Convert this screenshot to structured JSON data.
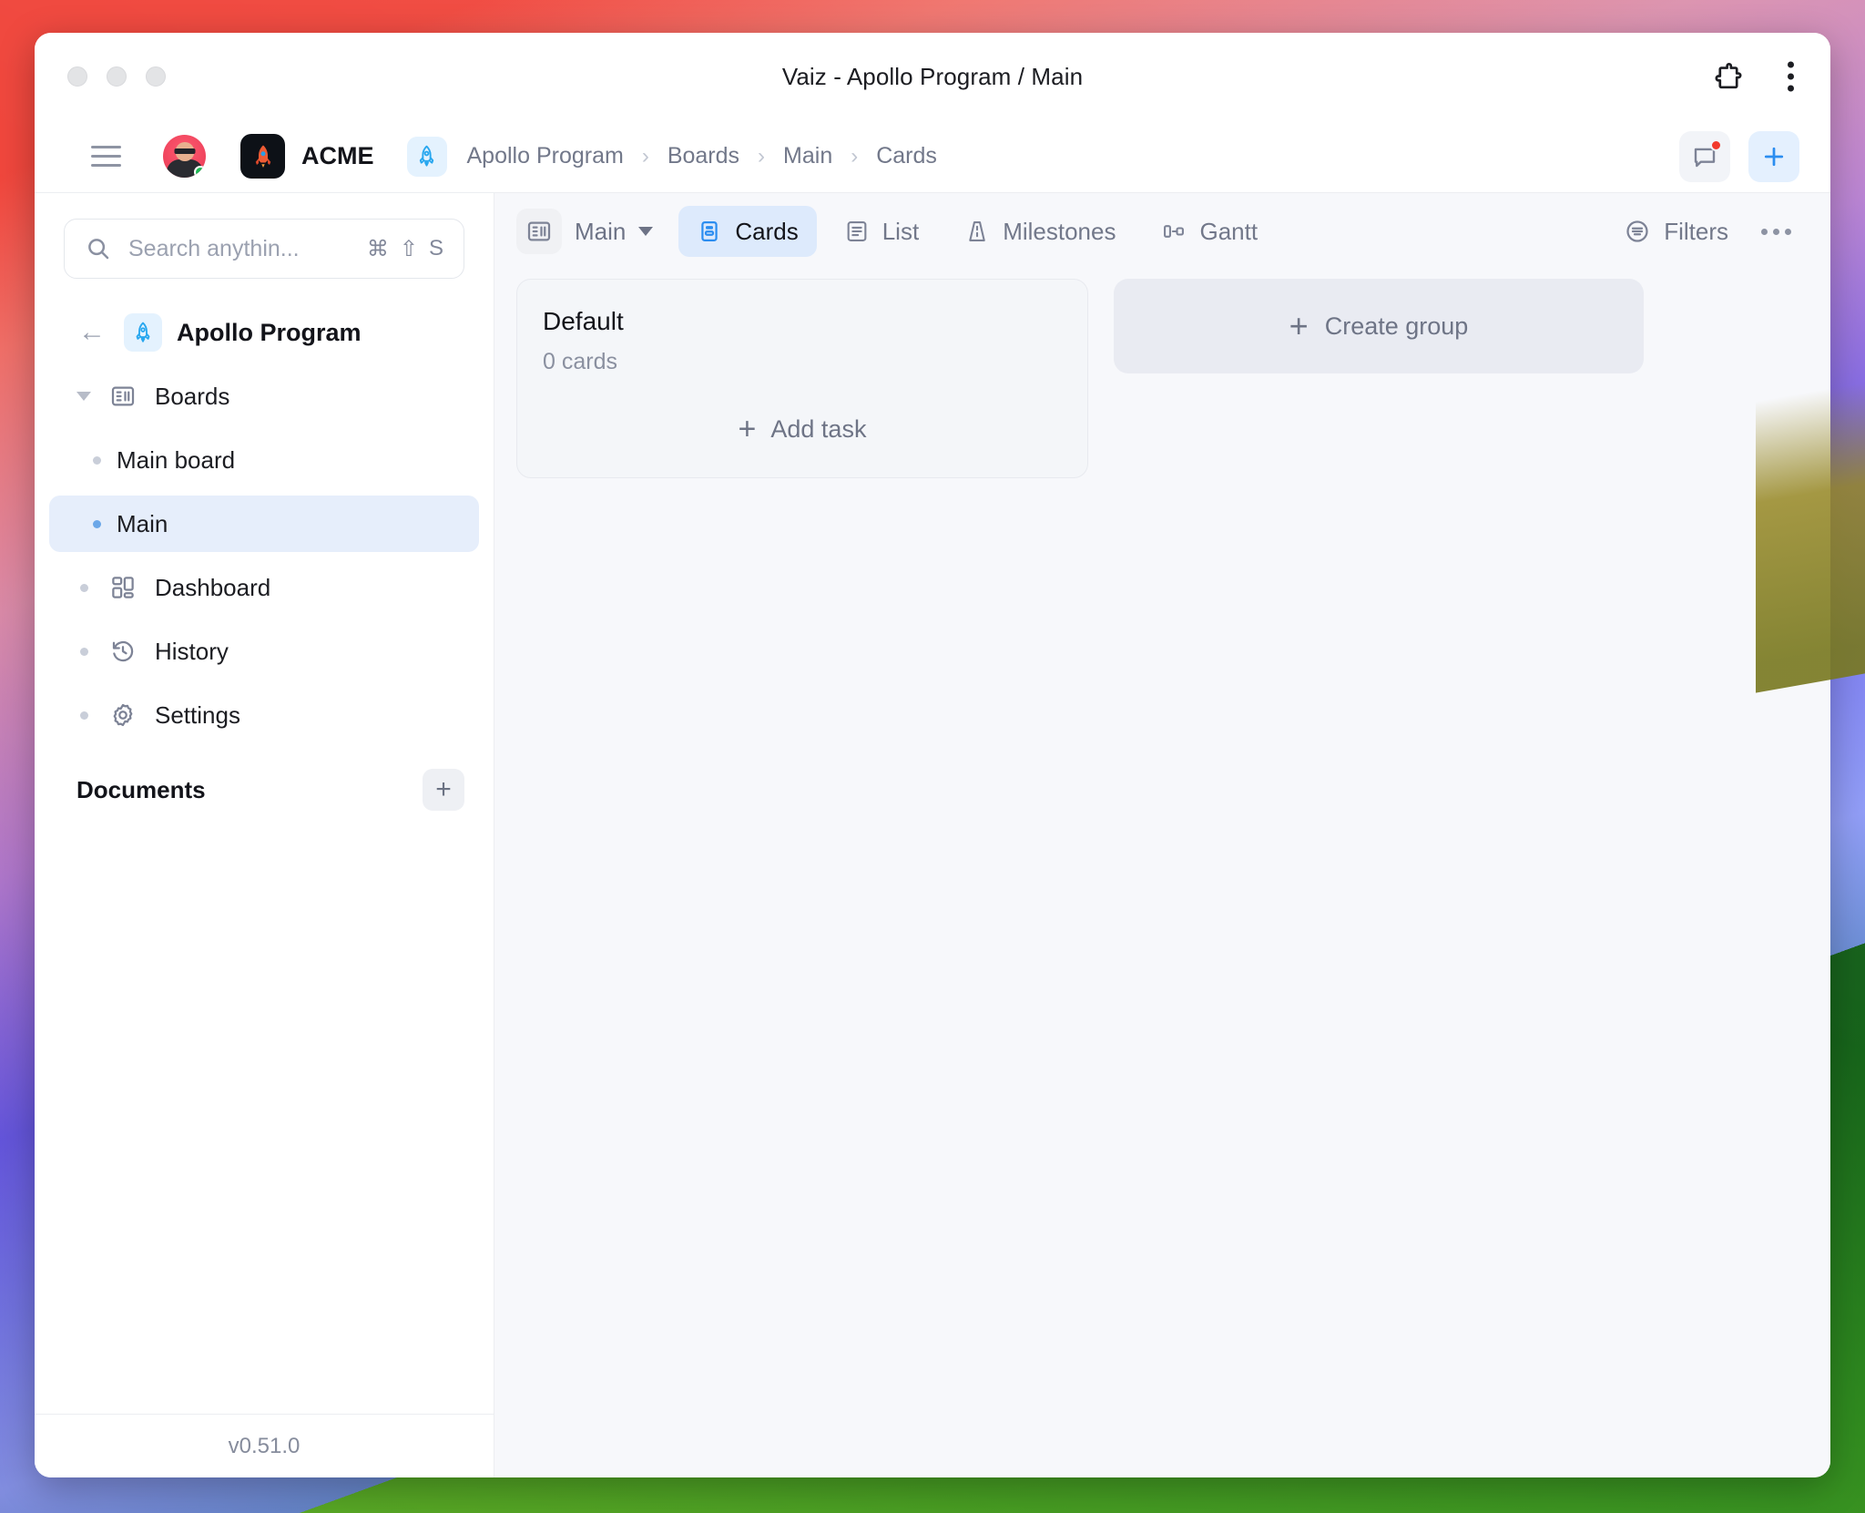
{
  "window": {
    "title": "Vaiz - Apollo Program / Main",
    "traffic_lights": [
      "close",
      "minimize",
      "maximize"
    ],
    "extensions_icon": "puzzle-piece-icon",
    "menu_icon": "kebab-menu-icon"
  },
  "navbar": {
    "menu_icon": "hamburger-menu-icon",
    "avatar": "user-avatar",
    "org_name": "ACME",
    "org_logo_icon": "rocket-logo-icon",
    "project_icon": "rocket-icon",
    "breadcrumb": [
      {
        "label": "Apollo Program"
      },
      {
        "label": "Boards"
      },
      {
        "label": "Main"
      },
      {
        "label": "Cards"
      }
    ],
    "breadcrumb_separator": "›",
    "notifications_icon": "chat-bubble-icon",
    "has_notification": true,
    "add_icon": "plus-icon"
  },
  "sidebar": {
    "search": {
      "placeholder": "Search anythin...",
      "icon": "search-icon",
      "shortcut": [
        "⌘",
        "⇧",
        "S"
      ]
    },
    "back_icon": "arrow-left-icon",
    "project": {
      "name": "Apollo Program",
      "icon": "rocket-icon"
    },
    "items": [
      {
        "label": "Boards",
        "icon": "board-icon",
        "type": "group",
        "expanded": true,
        "selected": false
      },
      {
        "label": "Main board",
        "icon": "",
        "type": "child",
        "selected": false
      },
      {
        "label": "Main",
        "icon": "",
        "type": "child",
        "selected": true
      },
      {
        "label": "Dashboard",
        "icon": "dashboard-icon",
        "type": "item",
        "selected": false
      },
      {
        "label": "History",
        "icon": "history-icon",
        "type": "item",
        "selected": false
      },
      {
        "label": "Settings",
        "icon": "gear-icon",
        "type": "item",
        "selected": false
      }
    ],
    "documents_section": {
      "title": "Documents",
      "add_icon": "plus-icon"
    },
    "version": "v0.51.0"
  },
  "toolbar": {
    "board_icon": "board-icon",
    "board_name": "Main",
    "board_caret": "chevron-down-icon",
    "tabs": [
      {
        "label": "Cards",
        "icon": "cards-icon",
        "active": true
      },
      {
        "label": "List",
        "icon": "list-icon",
        "active": false
      },
      {
        "label": "Milestones",
        "icon": "milestones-icon",
        "active": false
      },
      {
        "label": "Gantt",
        "icon": "gantt-icon",
        "active": false
      }
    ],
    "filters_label": "Filters",
    "filters_icon": "filter-icon",
    "more_icon": "more-horizontal-icon"
  },
  "board": {
    "groups": [
      {
        "title": "Default",
        "count_label": "0 cards",
        "add_task_label": "Add task",
        "add_task_icon": "plus-icon"
      }
    ],
    "create_group_label": "Create group",
    "create_group_icon": "plus-icon"
  },
  "colors": {
    "accent": "#3b8ff0",
    "active_tab_bg": "#ddeafc",
    "selected_item_bg": "#e6eefb",
    "notification": "#f2392c",
    "status_online": "#1db954",
    "main_bg": "#f7f8fb"
  }
}
